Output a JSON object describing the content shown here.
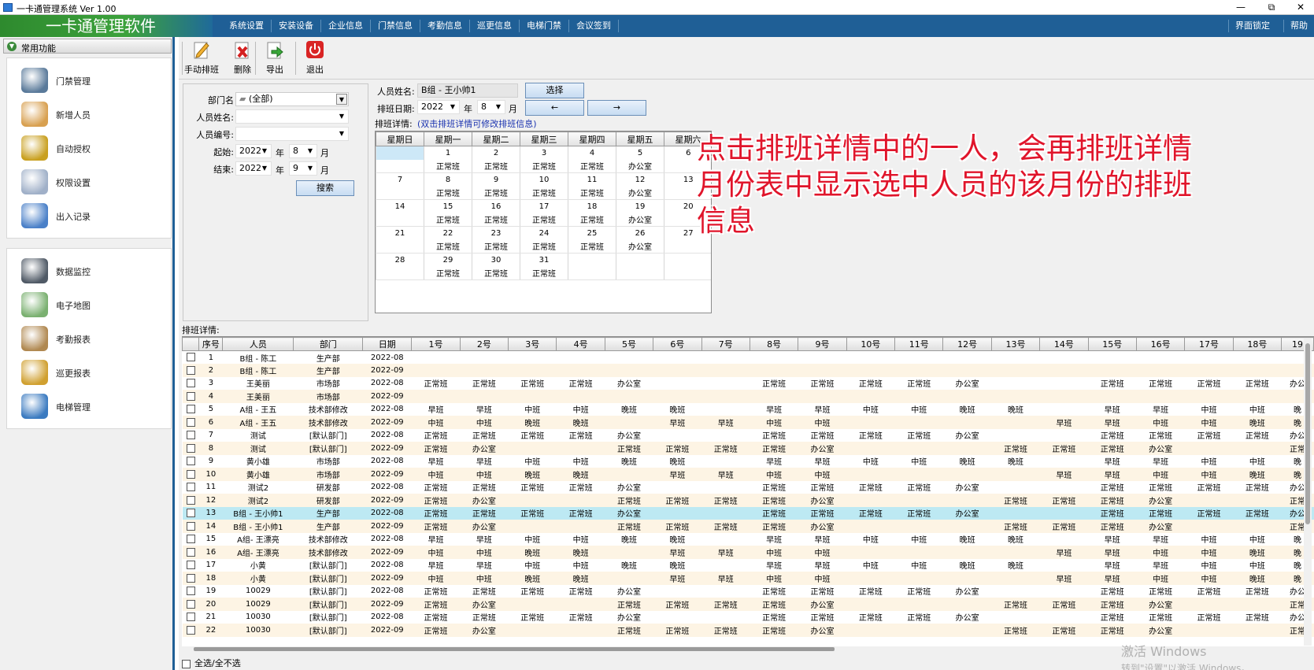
{
  "window": {
    "title": "一卡通管理系统 Ver 1.00",
    "buttons": {
      "minimize": "—",
      "restore": "⧉",
      "close": "✕"
    }
  },
  "brand": "一卡通管理软件",
  "menu": [
    "系统设置",
    "安装设备",
    "企业信息",
    "门禁信息",
    "考勤信息",
    "巡更信息",
    "电梯门禁",
    "会议签到"
  ],
  "menu_right": {
    "lock": "界面锁定",
    "help": "帮助"
  },
  "sidebar": {
    "header": "常用功能",
    "group1": [
      {
        "label": "门禁管理",
        "icon": "access-control-icon"
      },
      {
        "label": "新增人员",
        "icon": "add-person-icon"
      },
      {
        "label": "自动授权",
        "icon": "auto-authorize-icon"
      },
      {
        "label": "权限设置",
        "icon": "permission-icon"
      },
      {
        "label": "出入记录",
        "icon": "records-search-icon"
      }
    ],
    "group2": [
      {
        "label": "数据监控",
        "icon": "camera-monitor-icon"
      },
      {
        "label": "电子地图",
        "icon": "map-icon"
      },
      {
        "label": "考勤报表",
        "icon": "attendance-report-icon"
      },
      {
        "label": "巡更报表",
        "icon": "patrol-report-icon"
      },
      {
        "label": "电梯管理",
        "icon": "elevator-icon"
      }
    ]
  },
  "toolbar": {
    "manual": "手动排班",
    "delete": "删除",
    "export": "导出",
    "exit": "退出"
  },
  "filter": {
    "dept_label": "部门名",
    "dept_value": "(全部)",
    "name_label": "人员姓名:",
    "name_value": "",
    "id_label": "人员编号:",
    "id_value": "",
    "start_label": "起始:",
    "start_year": "2022",
    "start_month": "8",
    "end_label": "结束:",
    "end_year": "2022",
    "end_month": "9",
    "year_unit": "年",
    "month_unit": "月",
    "search": "搜索"
  },
  "schedule": {
    "person_label": "人员姓名:",
    "person_value": "B组 - 王小帅1",
    "select": "选择",
    "date_label": "排班日期:",
    "year": "2022",
    "month": "8",
    "year_unit": "年",
    "month_unit": "月",
    "prev": "←",
    "next": "→",
    "detail_label": "排班详情:",
    "detail_hint": "(双击排班详情可修改排班信息)",
    "weekdays": [
      "星期日",
      "星期一",
      "星期二",
      "星期三",
      "星期四",
      "星期五",
      "星期六"
    ],
    "weeks": [
      {
        "days": [
          "",
          "1",
          "2",
          "3",
          "4",
          "5",
          "6"
        ],
        "shifts": [
          "",
          "正常班",
          "正常班",
          "正常班",
          "正常班",
          "办公室",
          ""
        ]
      },
      {
        "days": [
          "7",
          "8",
          "9",
          "10",
          "11",
          "12",
          "13"
        ],
        "shifts": [
          "",
          "正常班",
          "正常班",
          "正常班",
          "正常班",
          "办公室",
          ""
        ]
      },
      {
        "days": [
          "14",
          "15",
          "16",
          "17",
          "18",
          "19",
          "20"
        ],
        "shifts": [
          "",
          "正常班",
          "正常班",
          "正常班",
          "正常班",
          "办公室",
          ""
        ]
      },
      {
        "days": [
          "21",
          "22",
          "23",
          "24",
          "25",
          "26",
          "27"
        ],
        "shifts": [
          "",
          "正常班",
          "正常班",
          "正常班",
          "正常班",
          "办公室",
          ""
        ]
      },
      {
        "days": [
          "28",
          "29",
          "30",
          "31",
          "",
          "",
          ""
        ],
        "shifts": [
          "",
          "正常班",
          "正常班",
          "正常班",
          "",
          "",
          ""
        ]
      }
    ]
  },
  "annotation": "点击排班详情中的一人，会再排班详情月份表中显示选中人员的该月份的排班信息",
  "grid": {
    "label": "排班详情:",
    "columns": [
      "",
      "序号",
      "人员",
      "部门",
      "日期",
      "1号",
      "2号",
      "3号",
      "4号",
      "5号",
      "6号",
      "7号",
      "8号",
      "9号",
      "10号",
      "11号",
      "12号",
      "13号",
      "14号",
      "15号",
      "16号",
      "17号",
      "18号",
      "19"
    ],
    "selected_row": 12,
    "rows": [
      [
        "1",
        "B组 - 陈工",
        "生产部",
        "2022-08",
        "",
        "",
        "",
        "",
        "",
        "",
        "",
        "",
        "",
        "",
        "",
        "",
        "",
        "",
        "",
        "",
        "",
        "",
        ""
      ],
      [
        "2",
        "B组 - 陈工",
        "生产部",
        "2022-09",
        "",
        "",
        "",
        "",
        "",
        "",
        "",
        "",
        "",
        "",
        "",
        "",
        "",
        "",
        "",
        "",
        "",
        "",
        ""
      ],
      [
        "3",
        "王美丽",
        "市场部",
        "2022-08",
        "正常班",
        "正常班",
        "正常班",
        "正常班",
        "办公室",
        "",
        "",
        "正常班",
        "正常班",
        "正常班",
        "正常班",
        "办公室",
        "",
        "",
        "正常班",
        "正常班",
        "正常班",
        "正常班",
        "办公"
      ],
      [
        "4",
        "王美丽",
        "市场部",
        "2022-09",
        "",
        "",
        "",
        "",
        "",
        "",
        "",
        "",
        "",
        "",
        "",
        "",
        "",
        "",
        "",
        "",
        "",
        "",
        ""
      ],
      [
        "5",
        "A组 - 王五",
        "技术部修改",
        "2022-08",
        "早班",
        "早班",
        "中班",
        "中班",
        "晚班",
        "晚班",
        "",
        "早班",
        "早班",
        "中班",
        "中班",
        "晚班",
        "晚班",
        "",
        "早班",
        "早班",
        "中班",
        "中班",
        "晚"
      ],
      [
        "6",
        "A组 - 王五",
        "技术部修改",
        "2022-09",
        "中班",
        "中班",
        "晚班",
        "晚班",
        "",
        "早班",
        "早班",
        "中班",
        "中班",
        "",
        "",
        "",
        "",
        "早班",
        "早班",
        "中班",
        "中班",
        "晚班",
        "晚"
      ],
      [
        "7",
        "测试",
        "[默认部门]",
        "2022-08",
        "正常班",
        "正常班",
        "正常班",
        "正常班",
        "办公室",
        "",
        "",
        "正常班",
        "正常班",
        "正常班",
        "正常班",
        "办公室",
        "",
        "",
        "正常班",
        "正常班",
        "正常班",
        "正常班",
        "办公"
      ],
      [
        "8",
        "测试",
        "[默认部门]",
        "2022-09",
        "正常班",
        "办公室",
        "",
        "",
        "正常班",
        "正常班",
        "正常班",
        "正常班",
        "办公室",
        "",
        "",
        "",
        "正常班",
        "正常班",
        "正常班",
        "办公室",
        "",
        "",
        "正常"
      ],
      [
        "9",
        "黄小雄",
        "市场部",
        "2022-08",
        "早班",
        "早班",
        "中班",
        "中班",
        "晚班",
        "晚班",
        "",
        "早班",
        "早班",
        "中班",
        "中班",
        "晚班",
        "晚班",
        "",
        "早班",
        "早班",
        "中班",
        "中班",
        "晚"
      ],
      [
        "10",
        "黄小雄",
        "市场部",
        "2022-09",
        "中班",
        "中班",
        "晚班",
        "晚班",
        "",
        "早班",
        "早班",
        "中班",
        "中班",
        "",
        "",
        "",
        "",
        "早班",
        "早班",
        "中班",
        "中班",
        "晚班",
        "晚"
      ],
      [
        "11",
        "测试2",
        "研发部",
        "2022-08",
        "正常班",
        "正常班",
        "正常班",
        "正常班",
        "办公室",
        "",
        "",
        "正常班",
        "正常班",
        "正常班",
        "正常班",
        "办公室",
        "",
        "",
        "正常班",
        "正常班",
        "正常班",
        "正常班",
        "办公"
      ],
      [
        "12",
        "测试2",
        "研发部",
        "2022-09",
        "正常班",
        "办公室",
        "",
        "",
        "正常班",
        "正常班",
        "正常班",
        "正常班",
        "办公室",
        "",
        "",
        "",
        "正常班",
        "正常班",
        "正常班",
        "办公室",
        "",
        "",
        "正常"
      ],
      [
        "13",
        "B组 - 王小帅1",
        "生产部",
        "2022-08",
        "正常班",
        "正常班",
        "正常班",
        "正常班",
        "办公室",
        "",
        "",
        "正常班",
        "正常班",
        "正常班",
        "正常班",
        "办公室",
        "",
        "",
        "正常班",
        "正常班",
        "正常班",
        "正常班",
        "办公"
      ],
      [
        "14",
        "B组 - 王小帅1",
        "生产部",
        "2022-09",
        "正常班",
        "办公室",
        "",
        "",
        "正常班",
        "正常班",
        "正常班",
        "正常班",
        "办公室",
        "",
        "",
        "",
        "正常班",
        "正常班",
        "正常班",
        "办公室",
        "",
        "",
        "正常"
      ],
      [
        "15",
        "A组- 王漂亮",
        "技术部修改",
        "2022-08",
        "早班",
        "早班",
        "中班",
        "中班",
        "晚班",
        "晚班",
        "",
        "早班",
        "早班",
        "中班",
        "中班",
        "晚班",
        "晚班",
        "",
        "早班",
        "早班",
        "中班",
        "中班",
        "晚"
      ],
      [
        "16",
        "A组- 王漂亮",
        "技术部修改",
        "2022-09",
        "中班",
        "中班",
        "晚班",
        "晚班",
        "",
        "早班",
        "早班",
        "中班",
        "中班",
        "",
        "",
        "",
        "",
        "早班",
        "早班",
        "中班",
        "中班",
        "晚班",
        "晚"
      ],
      [
        "17",
        "小黄",
        "[默认部门]",
        "2022-08",
        "早班",
        "早班",
        "中班",
        "中班",
        "晚班",
        "晚班",
        "",
        "早班",
        "早班",
        "中班",
        "中班",
        "晚班",
        "晚班",
        "",
        "早班",
        "早班",
        "中班",
        "中班",
        "晚"
      ],
      [
        "18",
        "小黄",
        "[默认部门]",
        "2022-09",
        "中班",
        "中班",
        "晚班",
        "晚班",
        "",
        "早班",
        "早班",
        "中班",
        "中班",
        "",
        "",
        "",
        "",
        "早班",
        "早班",
        "中班",
        "中班",
        "晚班",
        "晚"
      ],
      [
        "19",
        "10029",
        "[默认部门]",
        "2022-08",
        "正常班",
        "正常班",
        "正常班",
        "正常班",
        "办公室",
        "",
        "",
        "正常班",
        "正常班",
        "正常班",
        "正常班",
        "办公室",
        "",
        "",
        "正常班",
        "正常班",
        "正常班",
        "正常班",
        "办公"
      ],
      [
        "20",
        "10029",
        "[默认部门]",
        "2022-09",
        "正常班",
        "办公室",
        "",
        "",
        "正常班",
        "正常班",
        "正常班",
        "正常班",
        "办公室",
        "",
        "",
        "",
        "正常班",
        "正常班",
        "正常班",
        "办公室",
        "",
        "",
        "正常"
      ],
      [
        "21",
        "10030",
        "[默认部门]",
        "2022-08",
        "正常班",
        "正常班",
        "正常班",
        "正常班",
        "办公室",
        "",
        "",
        "正常班",
        "正常班",
        "正常班",
        "正常班",
        "办公室",
        "",
        "",
        "正常班",
        "正常班",
        "正常班",
        "正常班",
        "办公"
      ],
      [
        "22",
        "10030",
        "[默认部门]",
        "2022-09",
        "正常班",
        "办公室",
        "",
        "",
        "正常班",
        "正常班",
        "正常班",
        "正常班",
        "办公室",
        "",
        "",
        "",
        "正常班",
        "正常班",
        "正常班",
        "办公室",
        "",
        "",
        "正常"
      ]
    ]
  },
  "select_all": "全选/全不选",
  "watermark": {
    "line1": "激活 Windows",
    "line2": "转到\"设置\"以激活 Windows。"
  },
  "colors": {
    "menubar": "#1f5f96",
    "brand_green": "#3ca23c",
    "annotation": "#e0152b",
    "row_alt": "#fdf4e4",
    "row_selected": "#bde9f3"
  }
}
